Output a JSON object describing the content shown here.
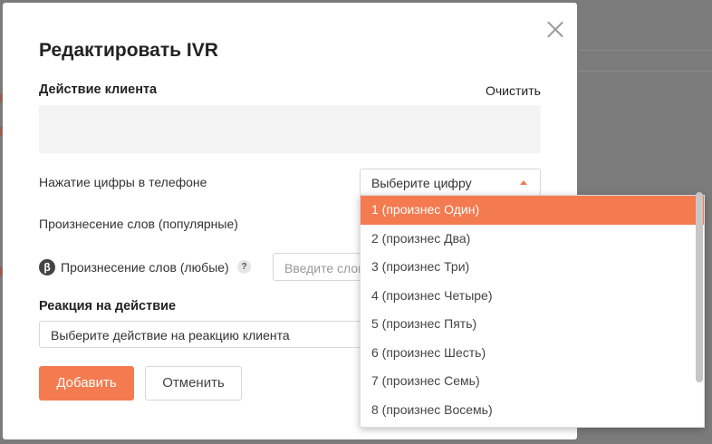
{
  "modal": {
    "title": "Редактировать IVR",
    "client_action_label": "Действие клиента",
    "clear_link": "Очистить",
    "digit_press_label": "Нажатие цифры в телефоне",
    "digit_select_value": "Выберите цифру",
    "words_popular_label": "Произнесение слов (популярные)",
    "words_any_label": "Произнесение слов (любые)",
    "beta_glyph": "β",
    "help_glyph": "?",
    "words_input_placeholder": "Введите слова",
    "reaction_label": "Реакция на действие",
    "reaction_select_value": "Выберите действие на реакцию клиента",
    "add_button": "Добавить",
    "cancel_button": "Отменить"
  },
  "dropdown": {
    "items": [
      "1 (произнес Один)",
      "2 (произнес Два)",
      "3 (произнес Три)",
      "4 (произнес Четыре)",
      "5 (произнес Пять)",
      "6 (произнес Шесть)",
      "7 (произнес Семь)",
      "8 (произнес Восемь)"
    ],
    "active_index": 0
  },
  "colors": {
    "accent": "#f47a4f",
    "overlay": "#7b7b7b"
  }
}
